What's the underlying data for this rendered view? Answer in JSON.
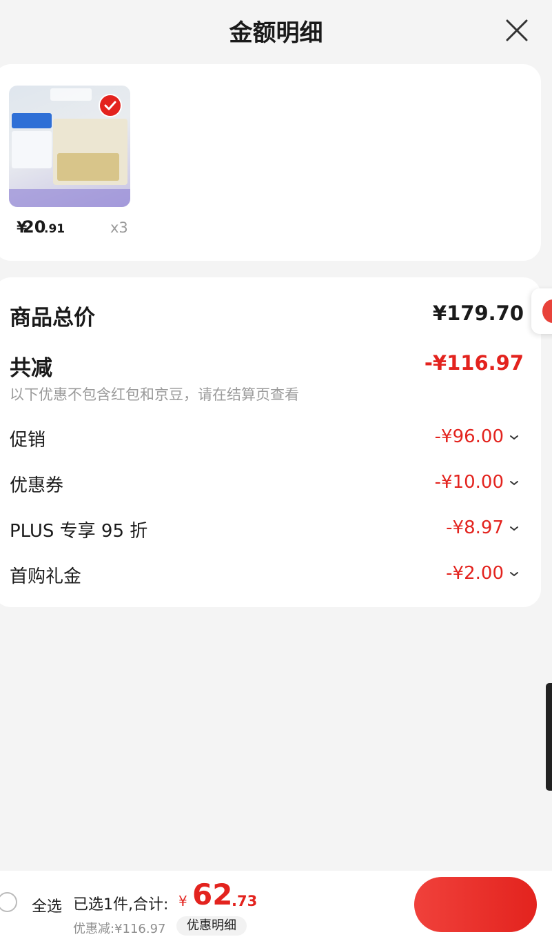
{
  "header": {
    "title": "金额明细"
  },
  "product": {
    "currency": "¥",
    "price_main": "20",
    "price_decimal": ".91",
    "quantity": "x3"
  },
  "summary": {
    "total_price_label": "商品总价",
    "total_price_value": "¥179.70",
    "total_discount_label": "共减",
    "total_discount_value": "-¥116.97",
    "note": "以下优惠不包含红包和京豆，请在结算页查看",
    "items": [
      {
        "label": "促销",
        "value": "-¥96.00"
      },
      {
        "label": "优惠券",
        "value": "-¥10.00"
      },
      {
        "label": "PLUS 专享 95 折",
        "value": "-¥8.97"
      },
      {
        "label": "首购礼金",
        "value": "-¥2.00"
      }
    ]
  },
  "bottom_bar": {
    "select_all": "全选",
    "selected_text": "已选1件,合计:",
    "currency": "¥",
    "total_main": "62",
    "total_decimal": ".73",
    "discount_text": "优惠减:¥116.97",
    "detail_button": "优惠明细"
  },
  "colors": {
    "accent": "#e3231e",
    "background": "#f4f4f4"
  }
}
